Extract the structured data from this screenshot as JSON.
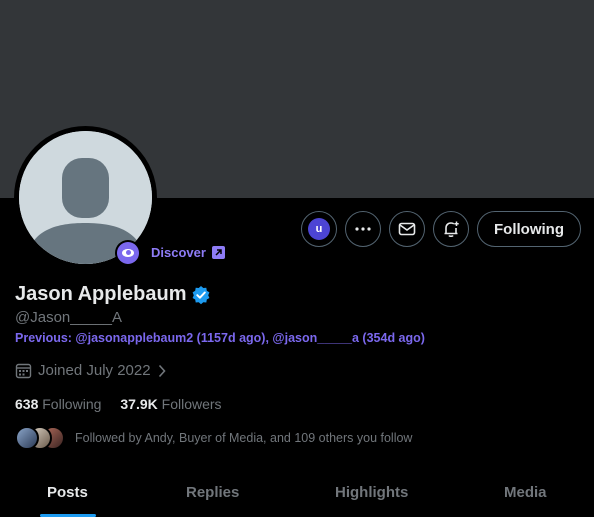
{
  "profile": {
    "name": "Jason Applebaum",
    "handle": "@Jason_____A",
    "previous": "Previous: @jasonapplebaum2 (1157d ago), @jason_____a (354d ago)",
    "joined": "Joined July 2022",
    "verified": true
  },
  "discover": {
    "label": "Discover"
  },
  "actions": {
    "u_badge": "u",
    "following_label": "Following"
  },
  "stats": {
    "following_count": "638",
    "following_label": "Following",
    "followers_count": "37.9K",
    "followers_label": "Followers"
  },
  "followed_by": {
    "text": "Followed by Andy, Buyer of Media, and 109 others you follow"
  },
  "tabs": [
    {
      "label": "Posts",
      "active": true
    },
    {
      "label": "Replies",
      "active": false
    },
    {
      "label": "Highlights",
      "active": false
    },
    {
      "label": "Media",
      "active": false
    }
  ],
  "colors": {
    "accent": "#1d9bf0",
    "banner": "#333639",
    "discover": "#8e7cf6"
  }
}
